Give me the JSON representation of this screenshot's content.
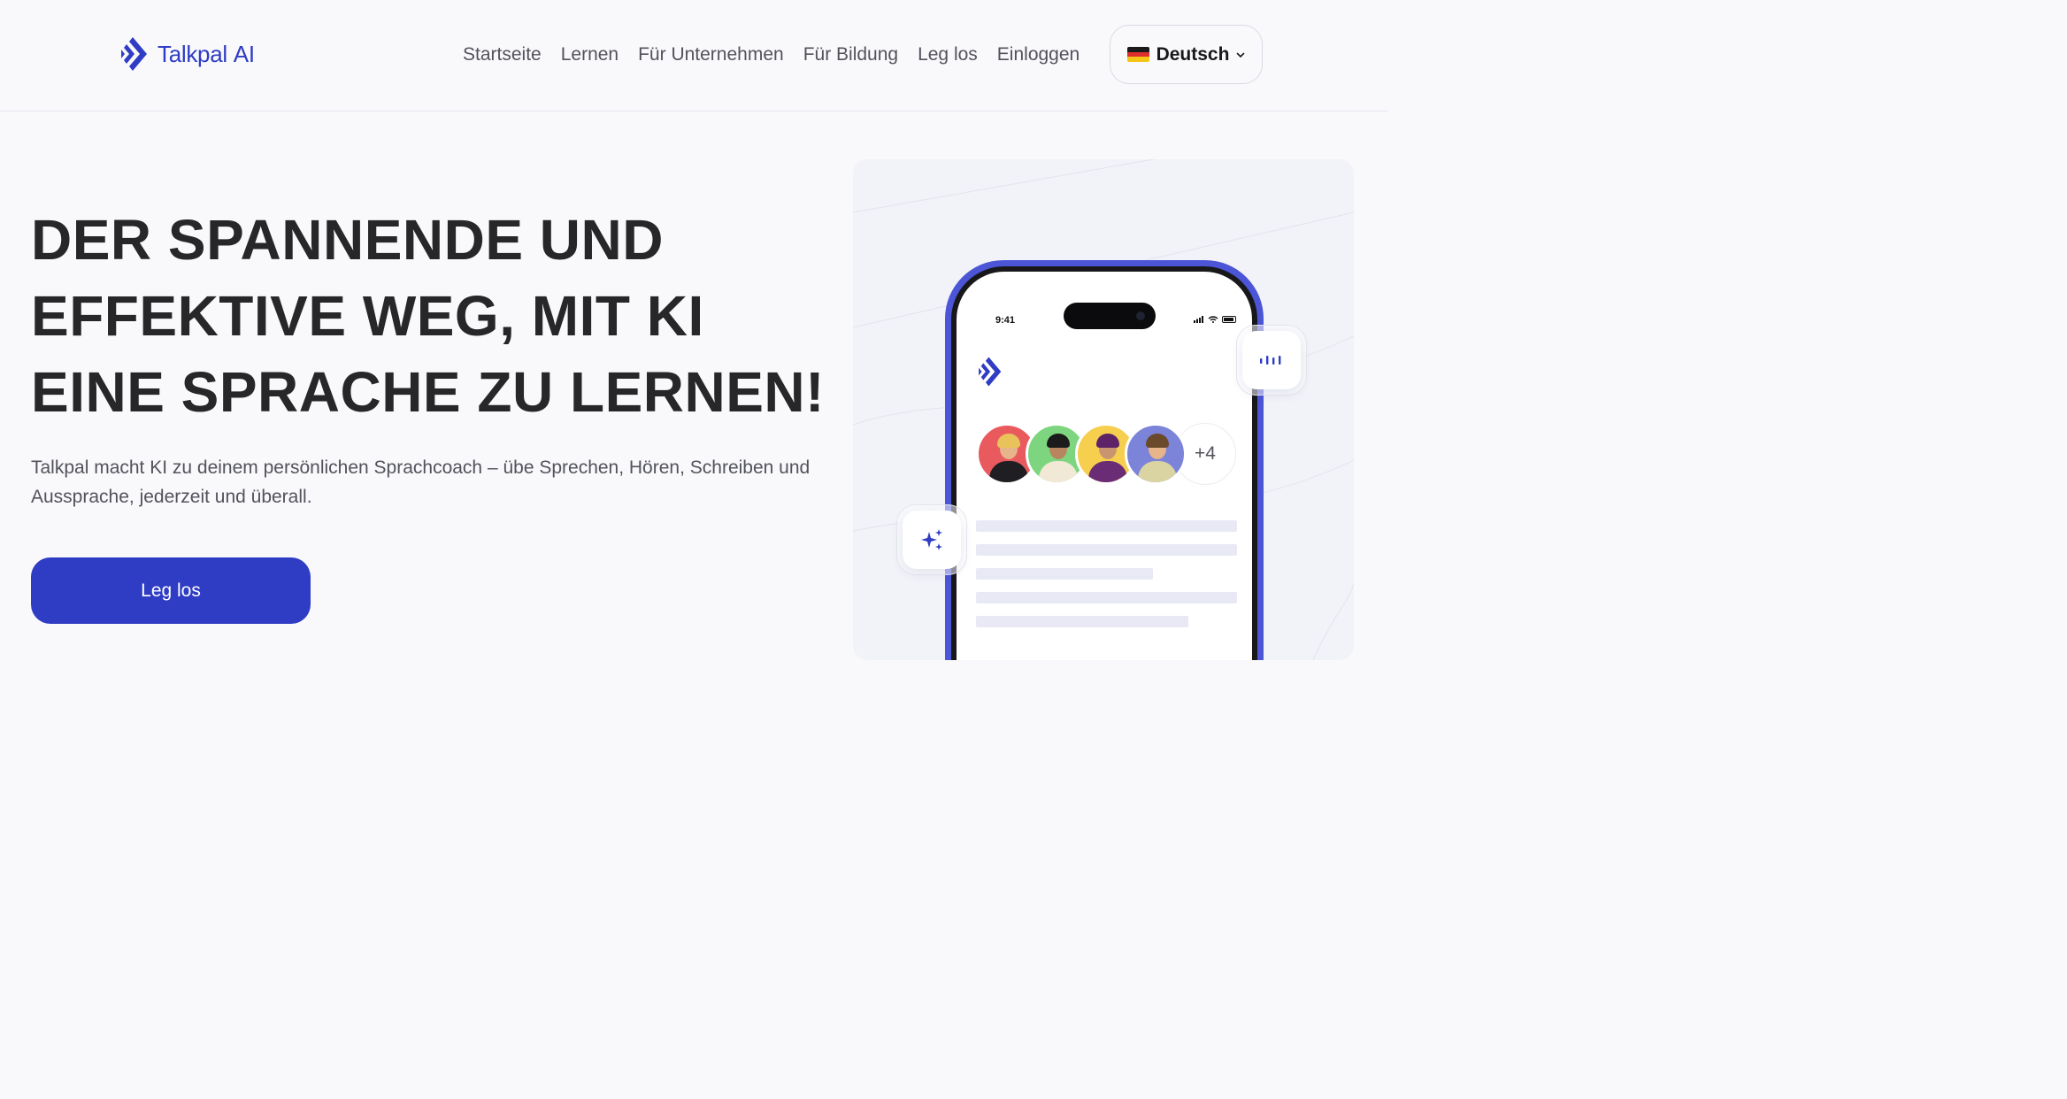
{
  "brand": {
    "name": "Talkpal",
    "suffix": "AI",
    "color": "#2f3cc4"
  },
  "nav": {
    "items": [
      "Startseite",
      "Lernen",
      "Für Unternehmen",
      "Für Bildung",
      "Leg los",
      "Einloggen"
    ]
  },
  "language": {
    "label": "Deutsch",
    "flag_icon": "germany-flag-icon",
    "chevron_icon": "chevron-down-icon"
  },
  "hero": {
    "title_lines": [
      "DER SPANNENDE UND",
      "EFFEKTIVE WEG, MIT KI",
      "EINE SPRACHE ZU LERNEN!"
    ],
    "subtitle": "Talkpal macht KI zu deinem persönlichen Sprachcoach – übe Sprechen, Hören, Schreiben und Aussprache, jederzeit und überall.",
    "cta_label": "Leg los"
  },
  "phone": {
    "status_time": "9:41",
    "avatars_more": "+4",
    "avatar_colors": [
      "#e95a5f",
      "#7dd67f",
      "#f6cf4f",
      "#7b84d9"
    ]
  },
  "colors": {
    "accent": "#2f3cc4",
    "phone_frame": "#4b55d6",
    "background": "#f9f9fc"
  }
}
